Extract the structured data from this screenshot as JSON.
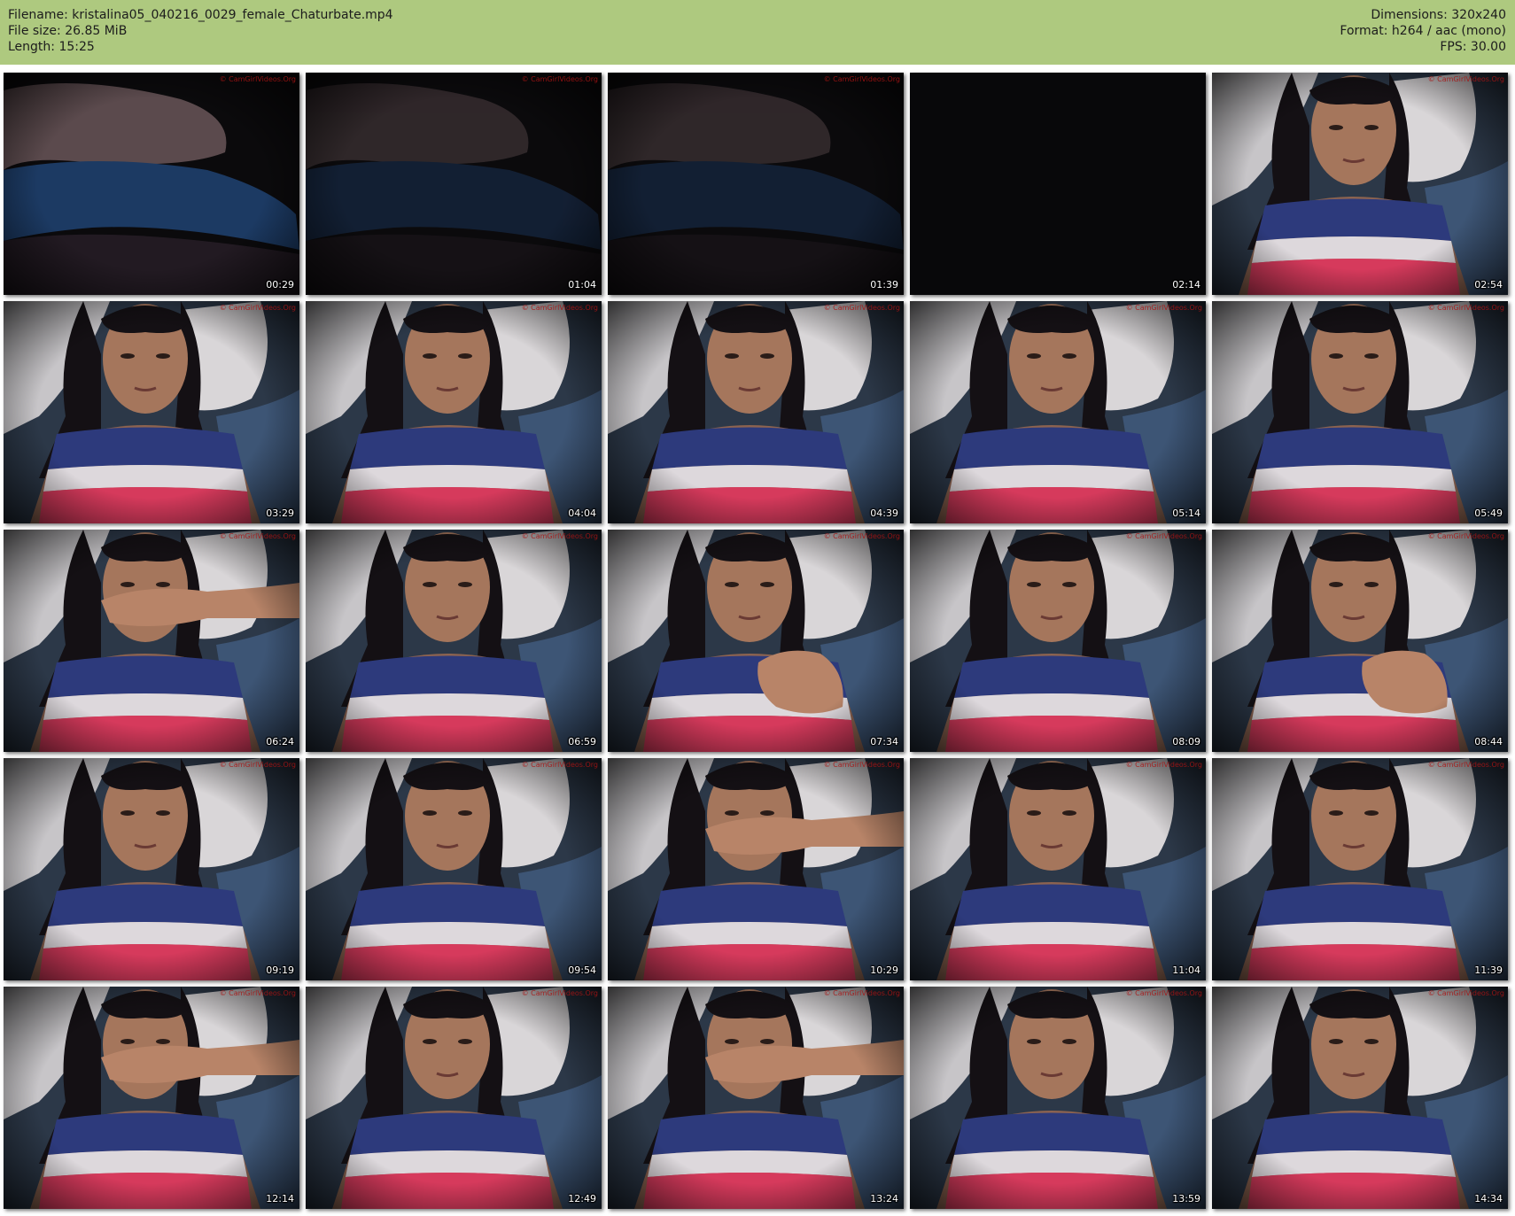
{
  "info": {
    "filename": "Filename: kristalina05_040216_0029_female_Chaturbate.mp4",
    "file_size": "File size: 26.85 MiB",
    "length": "Length: 15:25",
    "dimensions": "Dimensions: 320x240",
    "format": "Format: h264 / aac (mono)",
    "fps": "FPS: 30.00"
  },
  "watermark": "© CamGirlVideos.Org",
  "colors": {
    "header_bg": "#aec97f",
    "page_bg": "#ffffff"
  },
  "thumbnails": [
    {
      "time": "00:29",
      "scene": "dim-bed"
    },
    {
      "time": "01:04",
      "scene": "dark-bed"
    },
    {
      "time": "01:39",
      "scene": "dark-bed"
    },
    {
      "time": "02:14",
      "scene": "black"
    },
    {
      "time": "02:54",
      "scene": "person"
    },
    {
      "time": "03:29",
      "scene": "person"
    },
    {
      "time": "04:04",
      "scene": "person"
    },
    {
      "time": "04:39",
      "scene": "person"
    },
    {
      "time": "05:14",
      "scene": "person"
    },
    {
      "time": "05:49",
      "scene": "person"
    },
    {
      "time": "06:24",
      "scene": "person-hand-face"
    },
    {
      "time": "06:59",
      "scene": "person"
    },
    {
      "time": "07:34",
      "scene": "person-hand-chest"
    },
    {
      "time": "08:09",
      "scene": "person"
    },
    {
      "time": "08:44",
      "scene": "person-hand-chest"
    },
    {
      "time": "09:19",
      "scene": "person"
    },
    {
      "time": "09:54",
      "scene": "person"
    },
    {
      "time": "10:29",
      "scene": "person-hand-face"
    },
    {
      "time": "11:04",
      "scene": "person"
    },
    {
      "time": "11:39",
      "scene": "person"
    },
    {
      "time": "12:14",
      "scene": "person-hand-face"
    },
    {
      "time": "12:49",
      "scene": "person"
    },
    {
      "time": "13:24",
      "scene": "person-hand-face"
    },
    {
      "time": "13:59",
      "scene": "person"
    },
    {
      "time": "14:34",
      "scene": "person"
    }
  ]
}
